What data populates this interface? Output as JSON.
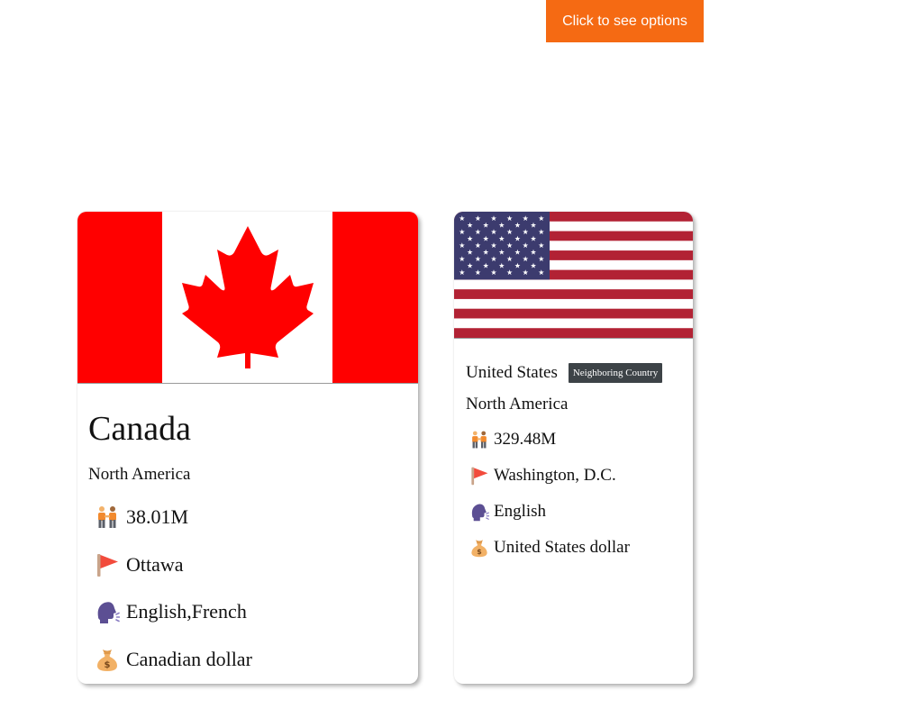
{
  "header": {
    "options_button_label": "Click to see options"
  },
  "countries": [
    {
      "name": "Canada",
      "region": "North America",
      "population": "38.01M",
      "capital": "Ottawa",
      "languages": "English,French",
      "currency": "Canadian dollar",
      "flag": "canada-flag"
    },
    {
      "name": "United States",
      "badge": "Neighboring Country",
      "region": "North America",
      "population": "329.48M",
      "capital": "Washington, D.C.",
      "languages": "English",
      "currency": "United States dollar",
      "flag": "usa-flag"
    }
  ],
  "icons": {
    "population": "people-icon",
    "capital": "flag-icon",
    "languages": "speaking-head-icon",
    "currency": "money-bag-icon"
  },
  "colors": {
    "accent_button": "#f56a13",
    "badge_bg": "#3d4347",
    "canada_red": "#ff0000",
    "usa_red": "#b22234",
    "usa_blue": "#3c3b6e"
  }
}
